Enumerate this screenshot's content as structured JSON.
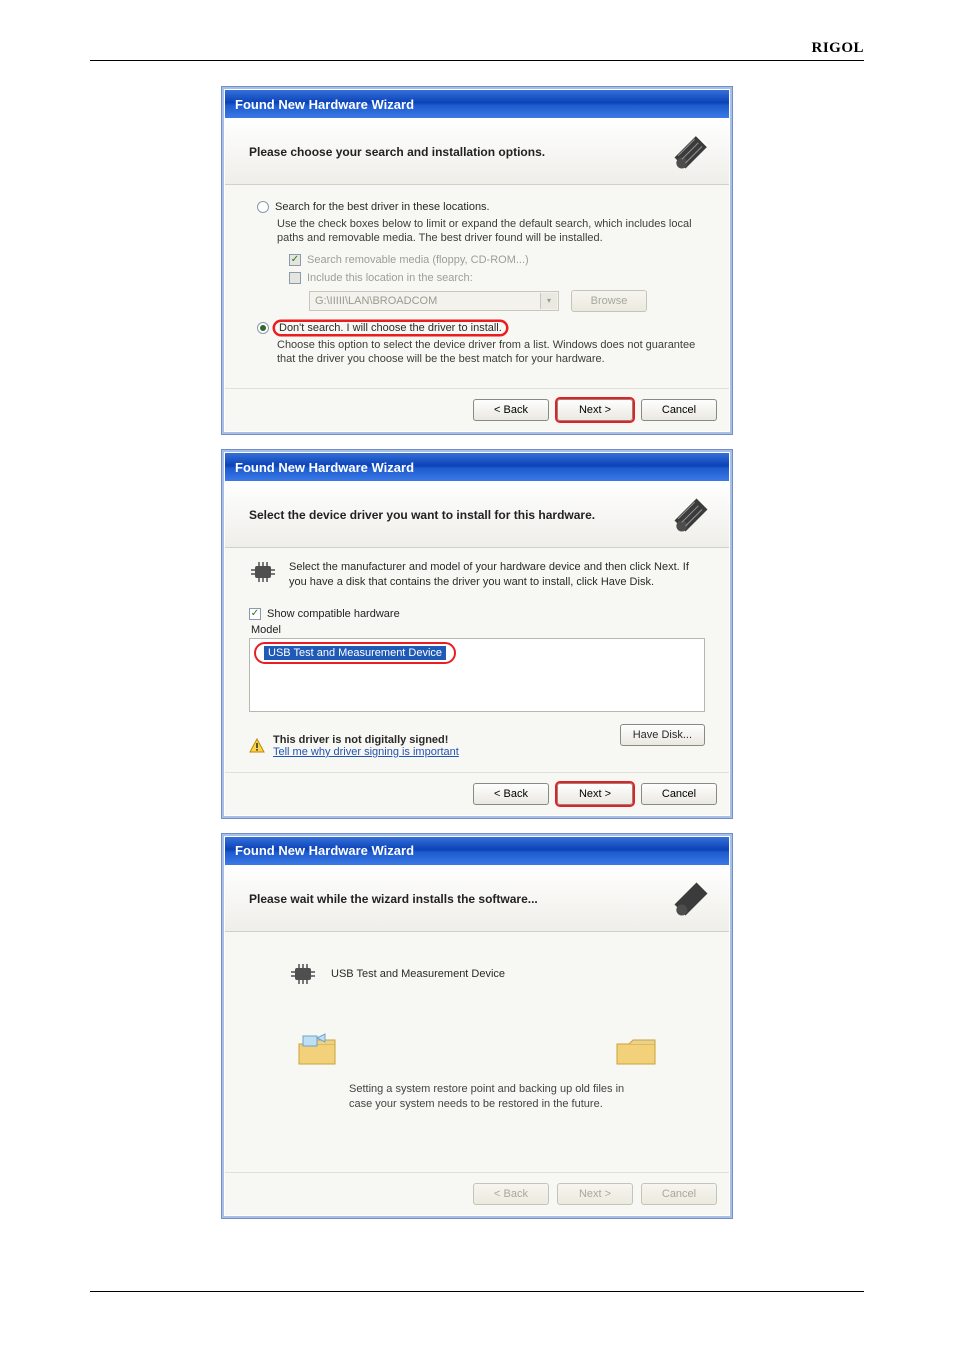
{
  "brand": "RIGOL",
  "dialog1": {
    "window_title": "Found New Hardware Wizard",
    "header_title": "Please choose your search and installation options.",
    "opt1": {
      "label": "Search for the best driver in these locations.",
      "desc": "Use the check boxes below to limit or expand the default search, which includes local paths and removable media. The best driver found will be installed.",
      "chk_removable": "Search removable media (floppy, CD-ROM...)",
      "chk_include": "Include this location in the search:",
      "path": "G:\\IIIII\\LAN\\BROADCOM",
      "browse": "Browse"
    },
    "opt2": {
      "label": "Don't search. I will choose the driver to install.",
      "desc": "Choose this option to select the device driver from a list.  Windows does not guarantee that the driver you choose will be the best match for your hardware."
    },
    "buttons": {
      "back": "< Back",
      "next": "Next >",
      "cancel": "Cancel"
    }
  },
  "dialog2": {
    "window_title": "Found New Hardware Wizard",
    "header_title": "Select the device driver you want to install for this hardware.",
    "instruction": "Select the manufacturer and model of your hardware device and then click Next. If you have a disk that contains the driver you want to install, click Have Disk.",
    "chk_compat": "Show compatible hardware",
    "col_model": "Model",
    "model_item": "USB Test and Measurement Device",
    "warn_bold": "This driver is not digitally signed!",
    "warn_link": "Tell me why driver signing is important",
    "have_disk": "Have Disk...",
    "buttons": {
      "back": "< Back",
      "next": "Next >",
      "cancel": "Cancel"
    }
  },
  "dialog3": {
    "window_title": "Found New Hardware Wizard",
    "header_title": "Please wait while the wizard installs the software...",
    "device": "USB Test and Measurement Device",
    "restore_note": "Setting a system restore point and backing up old files in case your system needs to be restored in the future.",
    "buttons": {
      "back": "< Back",
      "next": "Next >",
      "cancel": "Cancel"
    }
  }
}
